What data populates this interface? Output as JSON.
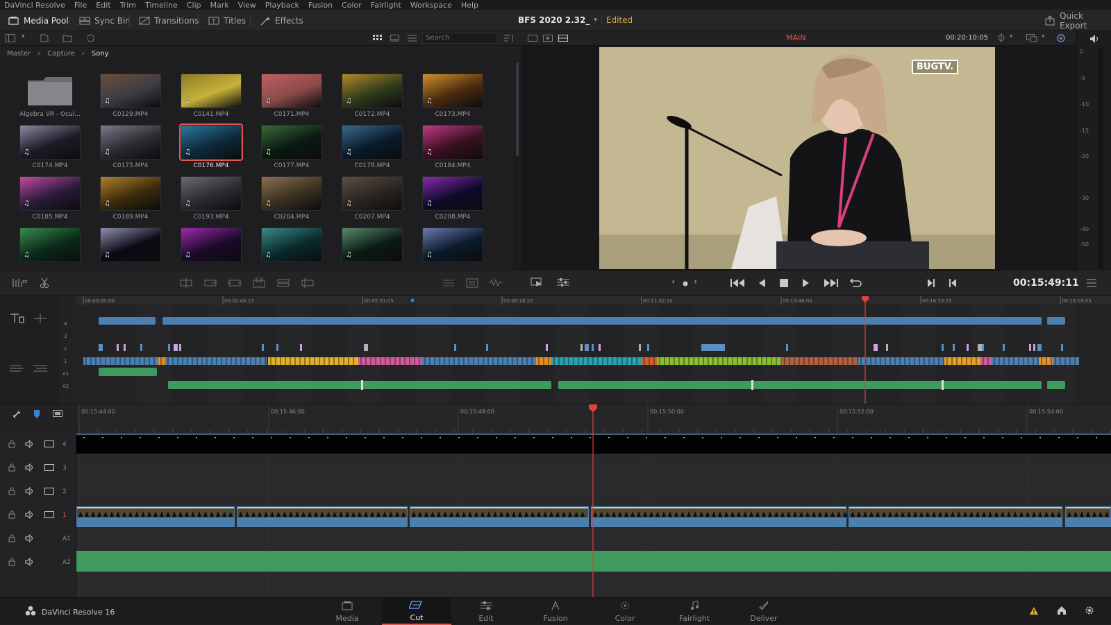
{
  "menu": [
    "DaVinci Resolve",
    "File",
    "Edit",
    "Trim",
    "Timeline",
    "Clip",
    "Mark",
    "View",
    "Playback",
    "Fusion",
    "Color",
    "Fairlight",
    "Workspace",
    "Help"
  ],
  "toolbar": {
    "media_pool": "Media Pool",
    "sync_bin": "Sync Bin",
    "transitions": "Transitions",
    "titles": "Titles",
    "effects": "Effects",
    "project_title": "BFS 2020 2.32_",
    "project_status": "Edited",
    "quick_export": "Quick Export"
  },
  "media_pool": {
    "search_placeholder": "Search",
    "breadcrumb": [
      "Master",
      "Capture",
      "Sony"
    ],
    "folder_name": "Algebra VR - Ocul...",
    "selected_clip": "C0176.MP4",
    "clips": [
      "C0129.MP4",
      "C0141.MP4",
      "C0171.MP4",
      "C0172.MP4",
      "C0173.MP4",
      "C0174.MP4",
      "C0175.MP4",
      "C0176.MP4",
      "C0177.MP4",
      "C0178.MP4",
      "C0184.MP4",
      "C0185.MP4",
      "C0189.MP4",
      "C0193.MP4",
      "C0204.MP4",
      "C0207.MP4",
      "C0208.MP4",
      "",
      "",
      "",
      "",
      "",
      ""
    ]
  },
  "viewer": {
    "mode_label": "MAIN",
    "source_timecode": "00:20:10:05",
    "watermark": "BUGTV.",
    "timecode": "00:15:49:11"
  },
  "meter_ticks": [
    "0",
    "-5",
    "-10",
    "-15",
    "-20",
    "-30",
    "-40",
    "-50"
  ],
  "upper_ruler": [
    "00:00:00:00",
    "00:02:45:15",
    "00:05:31:05",
    "00:08:16:20",
    "00:11:02:10",
    "00:13:48:00",
    "00:16:33:15",
    "00:19:19:05"
  ],
  "upper_tracks": [
    "4",
    "3",
    "2",
    "1",
    "A1",
    "A2"
  ],
  "lower_ruler": [
    "00:15:44:00",
    "00:15:46:00",
    "00:15:48:00",
    "00:15:50:00",
    "00:15:52:00",
    "00:15:54:00"
  ],
  "lower_tracks": [
    "4",
    "3",
    "2",
    "1",
    "A1",
    "A2"
  ],
  "footer": {
    "app_name": "DaVinci Resolve 16"
  },
  "pages": [
    "Media",
    "Cut",
    "Edit",
    "Fusion",
    "Color",
    "Fairlight",
    "Deliver"
  ],
  "active_page": "Cut",
  "colors": {
    "accent": "#e0564a",
    "video_clip": "#4a7fae",
    "audio_clip": "#3f9a5e",
    "playhead": "#e0423a"
  }
}
